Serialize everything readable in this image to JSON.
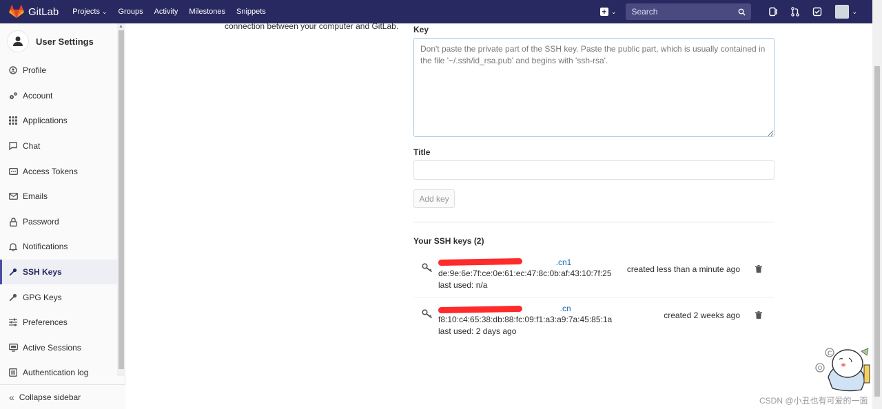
{
  "nav": {
    "brand": "GitLab",
    "links": [
      {
        "label": "Projects",
        "has_dropdown": true
      },
      {
        "label": "Groups",
        "has_dropdown": false
      },
      {
        "label": "Activity",
        "has_dropdown": false
      },
      {
        "label": "Milestones",
        "has_dropdown": false
      },
      {
        "label": "Snippets",
        "has_dropdown": false
      }
    ],
    "search_placeholder": "Search",
    "icons": [
      "plus-square-icon",
      "search-icon",
      "issues-icon",
      "merge-request-icon",
      "todo-check-icon",
      "avatar"
    ]
  },
  "sidebar": {
    "title": "User Settings",
    "items": [
      {
        "label": "Profile",
        "icon": "profile-icon"
      },
      {
        "label": "Account",
        "icon": "account-gears-icon"
      },
      {
        "label": "Applications",
        "icon": "applications-grid-icon"
      },
      {
        "label": "Chat",
        "icon": "chat-bubble-icon"
      },
      {
        "label": "Access Tokens",
        "icon": "token-icon"
      },
      {
        "label": "Emails",
        "icon": "envelope-icon"
      },
      {
        "label": "Password",
        "icon": "lock-icon"
      },
      {
        "label": "Notifications",
        "icon": "bell-icon"
      },
      {
        "label": "SSH Keys",
        "icon": "key-icon",
        "active": true
      },
      {
        "label": "GPG Keys",
        "icon": "key-icon"
      },
      {
        "label": "Preferences",
        "icon": "sliders-icon"
      },
      {
        "label": "Active Sessions",
        "icon": "monitor-icon"
      },
      {
        "label": "Authentication log",
        "icon": "list-icon"
      }
    ],
    "collapse_label": "Collapse sidebar"
  },
  "main": {
    "description_tail": "connection between your computer and GitLab.",
    "key_label": "Key",
    "key_placeholder": "Don't paste the private part of the SSH key. Paste the public part, which is usually contained in the file '~/.ssh/id_rsa.pub' and begins with 'ssh-rsa'.",
    "title_label": "Title",
    "title_value": "",
    "add_button": "Add key",
    "keys_heading": "Your SSH keys (2)",
    "keys": [
      {
        "name_visible_suffix": ".cn1",
        "fingerprint": "de:9e:6e:7f:ce:0e:61:ec:47:8c:0b:af:43:10:7f:25",
        "last_used": "last used: n/a",
        "created": "created less than a minute ago"
      },
      {
        "name_visible_suffix": ".cn",
        "fingerprint": "f8:10:c4:65:38:db:88:fc:09:f1:a3:a9:7a:45:85:1a",
        "last_used": "last used: 2 days ago",
        "created": "created 2 weeks ago"
      }
    ]
  },
  "watermark": "CSDN @小丑也有可爱的一面",
  "colors": {
    "nav_bg": "#292961",
    "active_accent": "#4b4ba3",
    "link": "#1b69b6",
    "redaction": "#ff2a2a"
  }
}
